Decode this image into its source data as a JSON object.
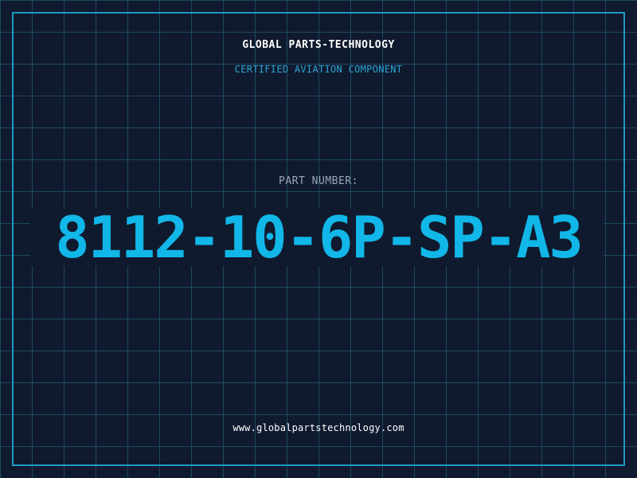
{
  "header": {
    "company_name": "GLOBAL PARTS-TECHNOLOGY",
    "tagline": "CERTIFIED AVIATION COMPONENT"
  },
  "part": {
    "label": "PART NUMBER:",
    "number": "8112-10-6P-SP-A3"
  },
  "footer": {
    "website": "www.globalpartstechnology.com"
  },
  "colors": {
    "background": "#101a2e",
    "grid": "#286e8c",
    "frame": "#1e9ac2",
    "accent": "#11b7e8",
    "tagline": "#2aa6d6",
    "label": "#9aa6b6",
    "text": "#ffffff"
  }
}
